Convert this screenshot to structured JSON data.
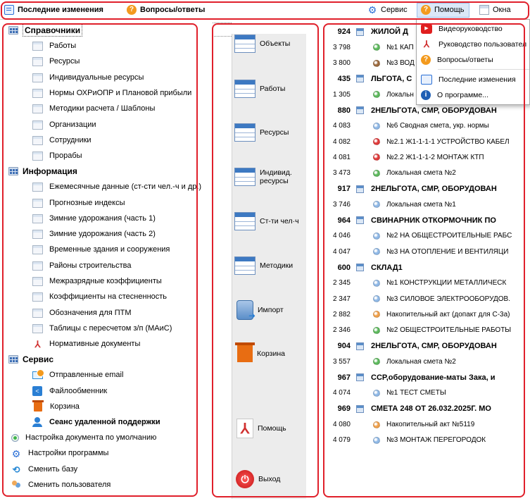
{
  "topbar": {
    "recent_changes": "Последние изменения",
    "faq": "Вопросы/ответы",
    "service": "Сервис",
    "help": "Помощь",
    "windows": "Окна"
  },
  "left": {
    "categories": [
      {
        "label": "Справочники"
      },
      {
        "label": "Информация"
      },
      {
        "label": "Сервис"
      }
    ],
    "reference_items": [
      "Работы",
      "Ресурсы",
      "Индивидуальные ресурсы",
      "Нормы ОХРиОПР и Плановой прибыли",
      "Методики расчета / Шаблоны",
      "Организации",
      "Сотрудники",
      "Прорабы"
    ],
    "info_items": [
      "Ежемесячные данные (ст-сти чел.-ч и др.)",
      "Прогнозные индексы",
      "Зимние удорожания (часть 1)",
      "Зимние удорожания (часть 2)",
      "Временные здания и сооружения",
      "Районы строительства",
      "Межразрядные коэффициенты",
      "Коэффициенты на стесненность",
      "Обозначения для ПТМ",
      "Таблицы с пересчетом з/п (МАиС)",
      "Нормативные документы"
    ],
    "service_items": [
      "Отправленные email",
      "Файлообменник",
      "Корзина",
      "Сеанс удаленной поддержки"
    ],
    "bottom_items": [
      "Настройка документа по умолчанию",
      "Настройки программы",
      "Сменить базу",
      "Сменить пользователя"
    ]
  },
  "mid": {
    "buttons": [
      "Объекты",
      "Работы",
      "Ресурсы",
      "Индивид. ресурсы",
      "Ст-ти чел·ч",
      "Методики",
      "Импорт",
      "Корзина",
      "Помощь",
      "Выход"
    ]
  },
  "right": {
    "rows": [
      {
        "num": "924",
        "name": "ЖИЛОЙ Д",
        "group": true
      },
      {
        "num": "3 798",
        "name": "№1 КАП",
        "color": "#5db95d"
      },
      {
        "num": "3 800",
        "name": "№3 ВОД",
        "color": "#9c6a3e"
      },
      {
        "num": "435",
        "name": "ЛЬГОТА, С",
        "group": true
      },
      {
        "num": "1 305",
        "name": "Локальн",
        "color": "#5db95d"
      },
      {
        "num": "880",
        "name": "2НЕЛЬГОТА, СМР, ОБОРУДОВАН",
        "group": true
      },
      {
        "num": "4 083",
        "name": "№6 Сводная смета, укр. нормы",
        "color": "#8fb8e6"
      },
      {
        "num": "4 082",
        "name": "№2.1 Ж1-1-1-1 УСТРОЙСТВО КАБЕЛ",
        "color": "#e03a3a"
      },
      {
        "num": "4 081",
        "name": "№2.2 Ж1-1-1-2 МОНТАЖ КТП",
        "color": "#e03a3a"
      },
      {
        "num": "3 473",
        "name": "Локальная смета №2",
        "color": "#5db95d"
      },
      {
        "num": "917",
        "name": "2НЕЛЬГОТА, СМР, ОБОРУДОВАН",
        "group": true
      },
      {
        "num": "3 746",
        "name": "Локальная смета №1",
        "color": "#8fb8e6"
      },
      {
        "num": "964",
        "name": "СВИНАРНИК ОТКОРМОЧНИК ПО",
        "group": true
      },
      {
        "num": "4 046",
        "name": "№2 НА ОБЩЕСТРОИТЕЛЬНЫЕ РАБС",
        "color": "#8fb8e6"
      },
      {
        "num": "4 047",
        "name": "№3 НА ОТОПЛЕНИЕ И ВЕНТИЛЯЦИ",
        "color": "#8fb8e6"
      },
      {
        "num": "600",
        "name": "СКЛАД1",
        "group": true
      },
      {
        "num": "2 345",
        "name": "№1 КОНСТРУКЦИИ МЕТАЛЛИЧЕСК",
        "color": "#8fb8e6"
      },
      {
        "num": "2 347",
        "name": "№3 СИЛОВОЕ ЭЛЕКТРООБОРУДОВ.",
        "color": "#8fb8e6"
      },
      {
        "num": "2 882",
        "name": "Накопительный акт (допакт для С-3а)",
        "color": "#f0a04a"
      },
      {
        "num": "2 346",
        "name": "№2 ОБЩЕСТРОИТЕЛЬНЫЕ РАБОТЫ",
        "color": "#5db95d"
      },
      {
        "num": "904",
        "name": "2НЕЛЬГОТА, СМР, ОБОРУДОВАН",
        "group": true
      },
      {
        "num": "3 557",
        "name": "Локальная смета №2",
        "color": "#5db95d"
      },
      {
        "num": "967",
        "name": "ССР,оборудование-маты Зака, и",
        "group": true
      },
      {
        "num": "4 074",
        "name": "№1 ТЕСТ СМЕТЫ",
        "color": "#8fb8e6"
      },
      {
        "num": "969",
        "name": "СМЕТА 248 ОТ 26.032.2025Г. МО",
        "group": true
      },
      {
        "num": "4 080",
        "name": "Накопительный акт №5119",
        "color": "#f0a04a"
      },
      {
        "num": "4 079",
        "name": "№3 МОНТАЖ ПЕРЕГОРОДОК",
        "color": "#8fb8e6"
      }
    ]
  },
  "help_menu": {
    "items": [
      "Видеоруководство",
      "Руководство пользовател",
      "Вопросы/ответы",
      "Последние изменения",
      "О программе..."
    ]
  }
}
